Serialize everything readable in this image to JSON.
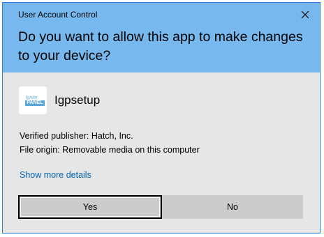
{
  "dialog": {
    "window_title": "User Account Control",
    "question": "Do you want to allow this app to make changes to your device?",
    "close_icon": "close-icon"
  },
  "app": {
    "logo_text_top": "Ignite",
    "logo_text_bottom": "PANEL",
    "name": "Igpsetup"
  },
  "details": {
    "publisher": "Verified publisher: Hatch, Inc.",
    "origin": "File origin: Removable media on this computer",
    "show_more_label": "Show more details"
  },
  "buttons": {
    "yes_label": "Yes",
    "no_label": "No"
  },
  "colors": {
    "header": "#77b9ee",
    "body": "#e6e6e6",
    "border": "#2b7fd4",
    "link": "#0063b1",
    "button": "#cccccc"
  }
}
